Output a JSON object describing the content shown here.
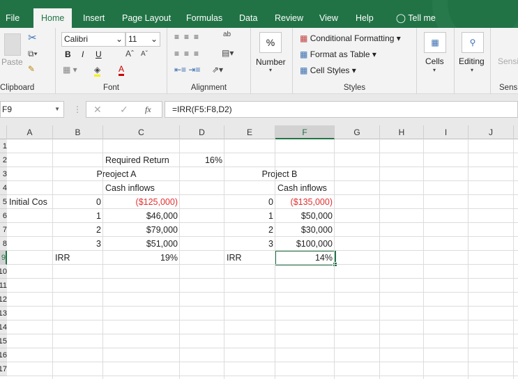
{
  "tabs": [
    "File",
    "Home",
    "Insert",
    "Page Layout",
    "Formulas",
    "Data",
    "Review",
    "View",
    "Help",
    "Tell me"
  ],
  "ribbon": {
    "clipboard": {
      "label": "Clipboard",
      "paste": "Paste"
    },
    "font": {
      "label": "Font",
      "name": "Calibri",
      "size": "11",
      "bold": "B",
      "italic": "I",
      "underline": "U"
    },
    "alignment": {
      "label": "Alignment"
    },
    "number": {
      "label": "Number",
      "symbol": "%"
    },
    "styles": {
      "label": "Styles",
      "conditional": "Conditional Formatting",
      "format_table": "Format as Table",
      "cell_styles": "Cell Styles"
    },
    "cells": {
      "label": "Cells"
    },
    "editing": {
      "label": "Editing"
    },
    "sensitivity": {
      "label": "Sensi",
      "button": "Sensi"
    }
  },
  "formula_bar": {
    "name_box": "F9",
    "formula": "=IRR(F5:F8,D2)",
    "fx": "fx"
  },
  "columns": [
    "A",
    "B",
    "C",
    "D",
    "E",
    "F",
    "G",
    "H",
    "I",
    "J"
  ],
  "selected_column": "F",
  "rows": [
    "1",
    "2",
    "3",
    "4",
    "5",
    "6",
    "7",
    "8",
    "9",
    "10",
    "11",
    "12",
    "13",
    "14",
    "15",
    "16",
    "17"
  ],
  "selected_row": "9",
  "cells": [
    {
      "ref": "C2",
      "value": "Required Return"
    },
    {
      "ref": "D2",
      "value": "16%"
    },
    {
      "ref": "C3",
      "value": "Preoject A"
    },
    {
      "ref": "F3",
      "value": "Project B"
    },
    {
      "ref": "C4",
      "value": "Cash inflows"
    },
    {
      "ref": "F4",
      "value": "Cash inflows"
    },
    {
      "ref": "A5",
      "value": "Initial Cos"
    },
    {
      "ref": "B5",
      "value": "0"
    },
    {
      "ref": "C5",
      "value": "($125,000)"
    },
    {
      "ref": "E5",
      "value": "0"
    },
    {
      "ref": "F5",
      "value": "($135,000)"
    },
    {
      "ref": "B6",
      "value": "1"
    },
    {
      "ref": "C6",
      "value": "$46,000"
    },
    {
      "ref": "E6",
      "value": "1"
    },
    {
      "ref": "F6",
      "value": "$50,000"
    },
    {
      "ref": "B7",
      "value": "2"
    },
    {
      "ref": "C7",
      "value": "$79,000"
    },
    {
      "ref": "E7",
      "value": "2"
    },
    {
      "ref": "F7",
      "value": "$30,000"
    },
    {
      "ref": "B8",
      "value": "3"
    },
    {
      "ref": "C8",
      "value": "$51,000"
    },
    {
      "ref": "E8",
      "value": "3"
    },
    {
      "ref": "F8",
      "value": "$100,000"
    },
    {
      "ref": "B9",
      "value": "IRR"
    },
    {
      "ref": "C9",
      "value": "19%"
    },
    {
      "ref": "E9",
      "value": "IRR"
    },
    {
      "ref": "F9",
      "value": "14%"
    }
  ],
  "colors": {
    "brand": "#217346",
    "negative": "#e03030"
  }
}
